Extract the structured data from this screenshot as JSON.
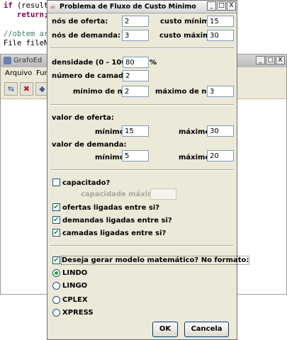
{
  "editor": {
    "lines": [
      "if (result",
      "return;",
      "//obtem ar",
      "File fileN"
    ]
  },
  "grafoed": {
    "title": "GrafoEd",
    "menu": [
      "Arquivo",
      "Fun"
    ],
    "window_buttons": [
      "_",
      "□",
      "X"
    ]
  },
  "dialog": {
    "title": "Problema de Fluxo de Custo Mínimo",
    "window_buttons": [
      "_",
      "□",
      "X"
    ],
    "nos_oferta": {
      "label": "nós de oferta:",
      "value": "2"
    },
    "custo_minimo": {
      "label": "custo mínimo:",
      "value": "15"
    },
    "nos_demanda": {
      "label": "nós de demanda:",
      "value": "3"
    },
    "custo_maximo": {
      "label": "custo máximo:",
      "value": "30"
    },
    "densidade": {
      "label": "densidade (0 - 100):",
      "value": "80",
      "unit": "%"
    },
    "numero_camadas": {
      "label": "número de camadas:",
      "value": "2"
    },
    "minimo_nos": {
      "label": "mínimo de nós:",
      "value": "2"
    },
    "maximo_nos": {
      "label": "máximo de nós:",
      "value": "3"
    },
    "valor_oferta": {
      "heading": "valor de oferta:",
      "min_label": "mínimo:",
      "min_value": "15",
      "max_label": "máximo:",
      "max_value": "30"
    },
    "valor_demanda": {
      "heading": "valor de demanda:",
      "min_label": "mínimo:",
      "min_value": "5",
      "max_label": "máximo:",
      "max_value": "20"
    },
    "capacitado": {
      "label": "capacitado?",
      "checked": false
    },
    "capacidade_maxima": {
      "label": "capacidade máxima:",
      "value": ""
    },
    "ofertas_ligadas": {
      "label": "ofertas ligadas entre si?",
      "checked": true
    },
    "demandas_ligadas": {
      "label": "demandas ligadas entre si?",
      "checked": true
    },
    "camadas_ligadas": {
      "label": "camadas ligadas entre si?",
      "checked": true
    },
    "gerar_modelo": {
      "label": "Deseja gerar modelo matemático? No formato:",
      "checked": true
    },
    "formats": [
      {
        "label": "LINDO",
        "selected": true
      },
      {
        "label": "LINGO",
        "selected": false
      },
      {
        "label": "CPLEX",
        "selected": false
      },
      {
        "label": "XPRESS",
        "selected": false
      }
    ],
    "ok_label": "OK",
    "cancel_label": "Cancela"
  },
  "colors": {
    "check_mark": "#21a121",
    "dialog_bg": "#ece9d8",
    "field_border": "#7f9db9"
  }
}
